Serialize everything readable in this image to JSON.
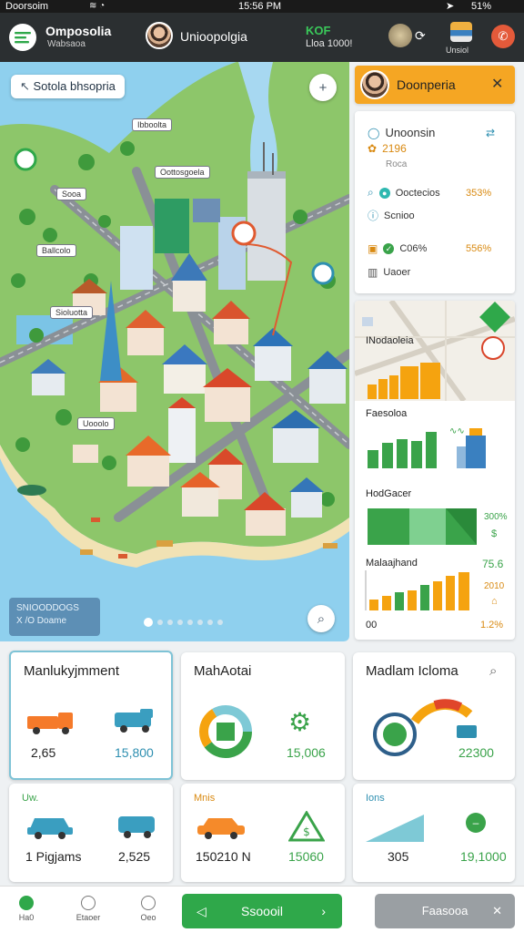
{
  "status": {
    "carrier": "Doorsoim",
    "time": "15:56 PM",
    "battery": "51%"
  },
  "appbar": {
    "app_name": "Omposolia",
    "app_sub": "Wabsaoa",
    "user_name": "Unioopolgia",
    "stat_label": "KOF",
    "stat_value": "Lloa 1000!",
    "right_label": "Unsiol"
  },
  "map": {
    "search_label": "Sotola bhsopria",
    "labels": [
      "Ibboolta",
      "Oottosgoela",
      "Sooa",
      "Ballcolo",
      "Sioluotta",
      "Uooolo"
    ],
    "legend_line1": "SNIOODDOGS",
    "legend_line2": "X /O Doame",
    "page_dots": 8,
    "active_dot": 0
  },
  "right": {
    "profile_name": "Doonperia",
    "info": {
      "title": "Unoonsin",
      "sub_value": "2196",
      "sub_label": "Roca",
      "row1_label": "Ooctecios",
      "row1_value": "353%",
      "row2_label": "Scnioo",
      "row3_label": "C06%",
      "row3_value": "556%",
      "row4_label": "Uaoer"
    },
    "chart1_title": "INodaoleia",
    "chart2_title": "Faesoloa",
    "chart3_title": "HodGacer",
    "chart3_value": "300%",
    "chart4_title": "Malaajhand",
    "chart4_value": "75.6",
    "chart4_sub": "2010",
    "chart4_bottom_left": "00",
    "chart4_bottom_right": "1.2%"
  },
  "cards": {
    "c1_title": "Manlukyjmment",
    "c1_left": "2,65",
    "c1_right": "15,800",
    "c2_title": "MahAotai",
    "c2_right": "15,006",
    "c3_title": "Madlam Icloma",
    "c3_right": "22300",
    "c4_title": "Uw.",
    "c4_left": "1 Pigjams",
    "c4_right": "2,525",
    "c5_title": "Mnis",
    "c5_left": "150210 N",
    "c5_right": "15060",
    "c6_title": "Ions",
    "c6_left": "305",
    "c6_right": "19,1000"
  },
  "nav": {
    "item1": "Ha0",
    "item2": "Etaoer",
    "item3": "Oeo",
    "primary_button": "Ssoooil",
    "secondary_button": "Faasooa"
  },
  "colors": {
    "accent_green": "#2fa84a",
    "accent_orange": "#f5a30f",
    "map_water": "#8fd0ee",
    "map_land": "#8dc66a"
  }
}
